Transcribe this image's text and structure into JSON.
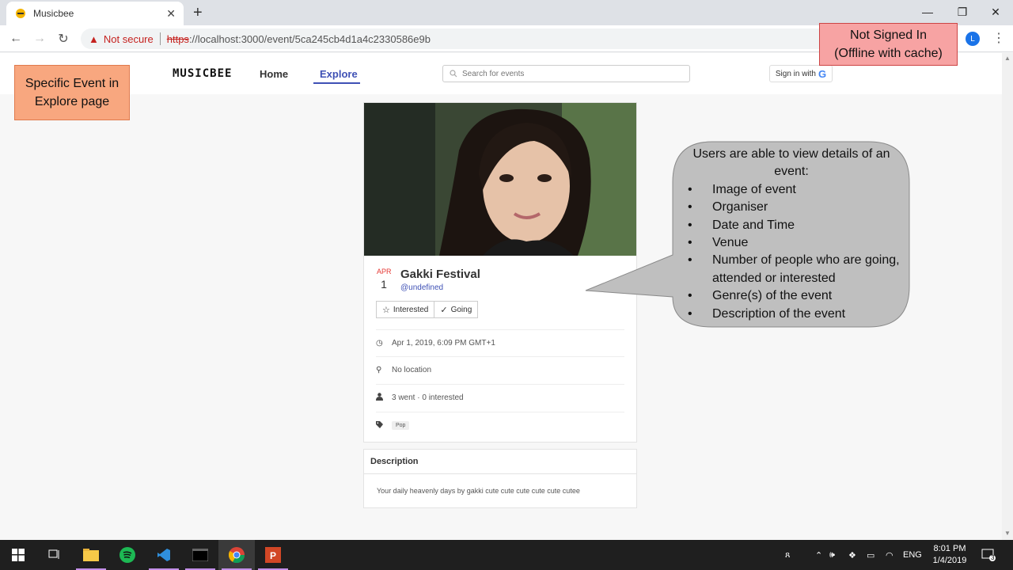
{
  "browser": {
    "tab_title": "Musicbee",
    "not_secure_label": "Not secure",
    "url_scheme": "https",
    "url_rest": "://localhost:3000/event/5ca245cb4d1a4c2330586e9b",
    "profile_initial": "L"
  },
  "header": {
    "logo": "MUSICBEE",
    "nav": [
      "Home",
      "Explore"
    ],
    "active_nav": "Explore",
    "search_placeholder": "Search for events",
    "signin_label": "Sign in with",
    "signin_logo": "G"
  },
  "event": {
    "month": "APR",
    "day": "1",
    "title": "Gakki Festival",
    "organiser": "@undefined",
    "interested_label": "Interested",
    "going_label": "Going",
    "datetime": "Apr 1, 2019, 6:09 PM GMT+1",
    "location": "No location",
    "attendance": "3 went · 0 interested",
    "genre_tag": "Pop",
    "description_heading": "Description",
    "description": "Your daily heavenly days by gakki cute cute cute cute cute cutee"
  },
  "annotations": {
    "left_box": "Specific Event in Explore page",
    "right_box_line1": "Not Signed In",
    "right_box_line2": "(Offline with cache)",
    "callout_heading": "Users are able to view details of an event:",
    "callout_items": [
      "Image of event",
      "Organiser",
      "Date and Time",
      "Venue",
      "Number of people who are going, attended or interested",
      "Genre(s) of the event",
      "Description of the event"
    ]
  },
  "taskbar": {
    "language": "ENG",
    "time": "8:01 PM",
    "date": "1/4/2019",
    "notification_count": "3"
  },
  "colors": {
    "accent": "#3f51b5",
    "date_red": "#e53935",
    "annotation_orange": "#f8a77f",
    "annotation_red": "#f7a3a3",
    "callout_gray": "#bfbfbf"
  }
}
